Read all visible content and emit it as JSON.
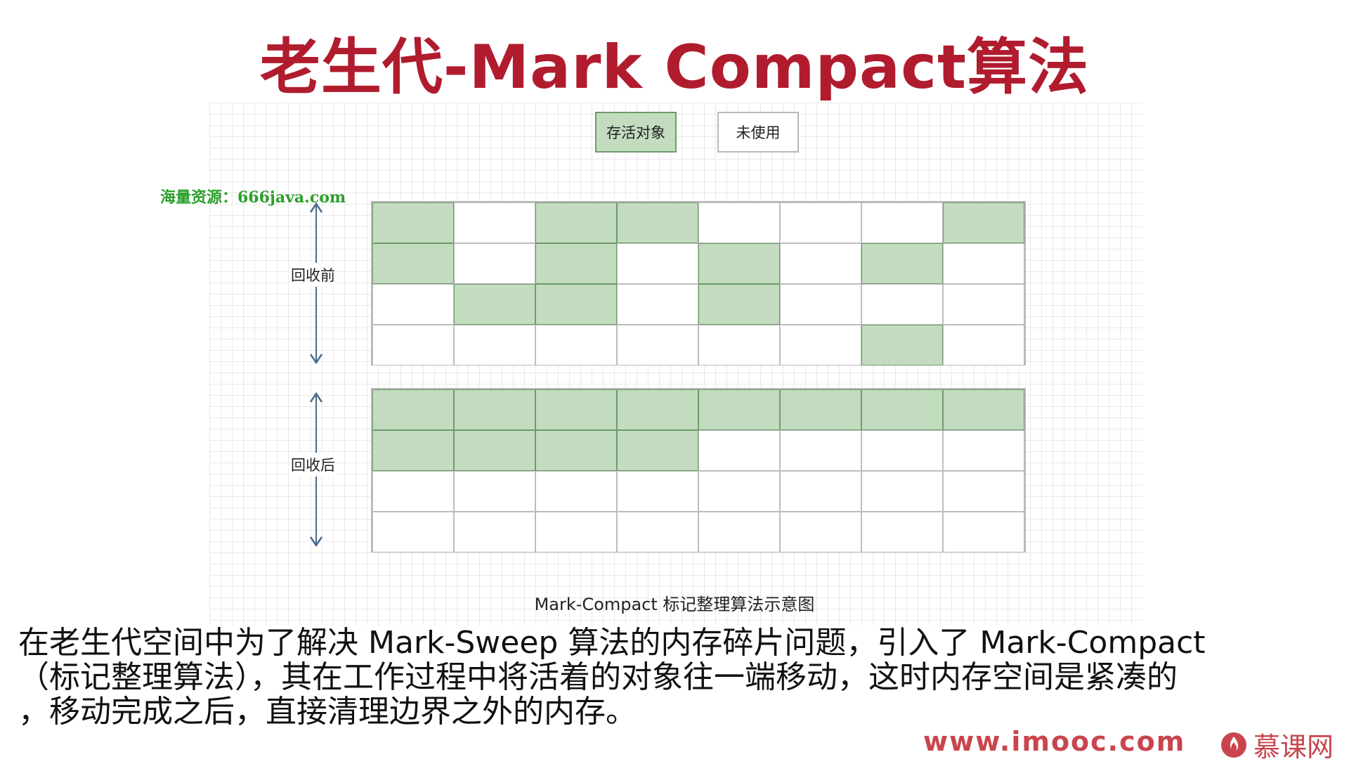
{
  "title": "老生代-Mark Compact算法",
  "legend": {
    "live_label": "存活对象",
    "free_label": "未使用"
  },
  "watermark_top": "海量资源：666java.com",
  "before": {
    "label": "回收前",
    "rows": [
      [
        1,
        0,
        1,
        1,
        0,
        0,
        0,
        1
      ],
      [
        1,
        0,
        1,
        0,
        1,
        0,
        1,
        0
      ],
      [
        0,
        1,
        1,
        0,
        1,
        0,
        0,
        0
      ],
      [
        0,
        0,
        0,
        0,
        0,
        0,
        1,
        0
      ]
    ]
  },
  "after": {
    "label": "回收后",
    "rows": [
      [
        1,
        1,
        1,
        1,
        1,
        1,
        1,
        1
      ],
      [
        1,
        1,
        1,
        1,
        0,
        0,
        0,
        0
      ],
      [
        0,
        0,
        0,
        0,
        0,
        0,
        0,
        0
      ],
      [
        0,
        0,
        0,
        0,
        0,
        0,
        0,
        0
      ]
    ]
  },
  "caption": "Mark-Compact 标记整理算法示意图",
  "body_lines": [
    "在老生代空间中为了解决 Mark-Sweep 算法的内存碎片问题，引入了 Mark-Compact",
    "（标记整理算法），其在工作过程中将活着的对象往一端移动，这时内存空间是紧凑的",
    "，移动完成之后，直接清理边界之外的内存。"
  ],
  "site": "www.imooc.com",
  "brand": "慕课网",
  "colors": {
    "live": "#c3dcc0",
    "title": "#b01c2e",
    "arrow": "#4a6b8c"
  }
}
